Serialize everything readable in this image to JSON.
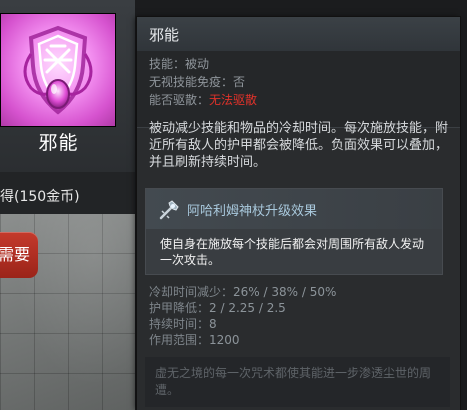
{
  "item": {
    "name": "邪能",
    "icon": "nullifier-item-icon"
  },
  "shop": {
    "price_text": "得(150金币)",
    "buy_button_label": "需要"
  },
  "tooltip": {
    "title": "邪能",
    "attributes": [
      {
        "label": "技能：",
        "value": "被动"
      },
      {
        "label": "无视技能免疫：",
        "value": "否"
      },
      {
        "label": "能否驱散：",
        "value": "无法驱散",
        "color": "#e0322a"
      }
    ],
    "description": "被动减少技能和物品的冷却时间。每次施放技能，附近所有敌人的护甲都会被降低。负面效果可以叠加，并且刷新持续时间。",
    "upgrade": {
      "icon": "aghanims-scepter-icon",
      "title": "阿哈利姆神杖升级效果",
      "text": "使自身在施放每个技能后都会对周围所有敌人发动一次攻击。"
    },
    "stats": [
      {
        "label": "冷却时间减少：",
        "value": "26% / 38% / 50%"
      },
      {
        "label": "护甲降低：",
        "value": "2 / 2.25 / 2.5"
      },
      {
        "label": "持续时间：",
        "value": "8"
      },
      {
        "label": "作用范围：",
        "value": "1200"
      }
    ],
    "lore": "虚无之境的每一次咒术都使其能进一步渗透尘世的周遭。"
  },
  "colors": {
    "accent_red": "#e0322a",
    "icon_pink": "#f38ff0",
    "upgrade_title": "#a9c9dd"
  }
}
